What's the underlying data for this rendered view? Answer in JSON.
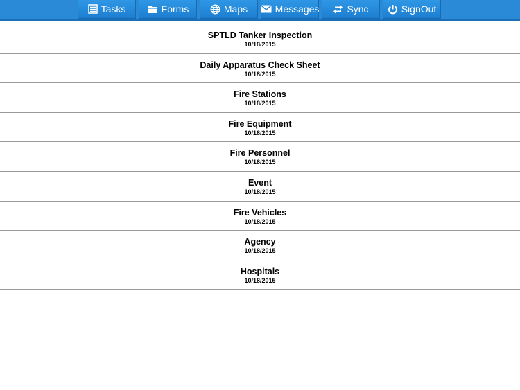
{
  "nav": {
    "tasks_label": "Tasks",
    "forms_label": "Forms",
    "maps_label": "Maps",
    "messages_label": "Messages",
    "sync_label": "Sync",
    "signout_label": "SignOut"
  },
  "colors": {
    "nav_background": "#2a8ad8",
    "button_background": "#1d7ed0",
    "divider": "#9a9a9a"
  },
  "icons": {
    "tasks": "list-icon",
    "forms": "folder-icon",
    "maps": "globe-icon",
    "messages": "envelope-icon",
    "sync": "sync-icon",
    "signout": "power-icon"
  },
  "forms_list": [
    {
      "title": "SPTLD Tanker Inspection",
      "date": "10/18/2015"
    },
    {
      "title": "Daily Apparatus Check Sheet",
      "date": "10/18/2015"
    },
    {
      "title": "Fire Stations",
      "date": "10/18/2015"
    },
    {
      "title": "Fire Equipment",
      "date": "10/18/2015"
    },
    {
      "title": "Fire Personnel",
      "date": "10/18/2015"
    },
    {
      "title": "Event",
      "date": "10/18/2015"
    },
    {
      "title": "Fire Vehicles",
      "date": "10/18/2015"
    },
    {
      "title": "Agency",
      "date": "10/18/2015"
    },
    {
      "title": "Hospitals",
      "date": "10/18/2015"
    }
  ]
}
